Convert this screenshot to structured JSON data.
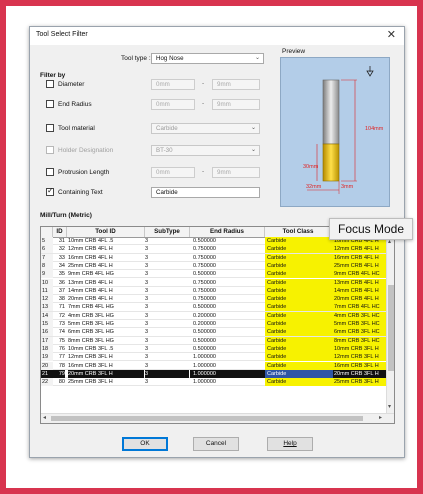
{
  "dialog": {
    "title": "Tool Select Filter",
    "close_glyph": "✕"
  },
  "tool_type": {
    "label": "Tool type :",
    "value": "Hog Nose"
  },
  "preview": {
    "label": "Preview",
    "dim_length": "104mm",
    "dim_flute": "30mm",
    "dim_width": "32mm",
    "dim_radius": "3mm"
  },
  "filter": {
    "heading": "Filter by",
    "diameter": {
      "label": "Diameter",
      "min": "0mm",
      "max": "9mm",
      "checked": false
    },
    "end_radius": {
      "label": "End Radius",
      "min": "0mm",
      "max": "9mm",
      "checked": false
    },
    "tool_material": {
      "label": "Tool material",
      "value": "Carbide",
      "checked": false
    },
    "holder_designation": {
      "label": "Holder Designation",
      "value": "BT-30",
      "checked": false,
      "enabled": false
    },
    "protrusion_length": {
      "label": "Protrusion Length",
      "min": "0mm",
      "max": "9mm",
      "checked": false
    },
    "containing_text": {
      "label": "Containing Text",
      "value": "Carbide",
      "checked": true
    },
    "dash": "-"
  },
  "grid": {
    "heading": "Mill/Turn (Metric)",
    "columns": [
      "",
      "ID",
      "Tool ID",
      "SubType",
      "End Radius",
      "Tool Class",
      ""
    ],
    "rows": [
      [
        "5",
        "31",
        "10mm CRB 4FL .5",
        "3",
        "0.500000",
        "Carbide",
        "10mm CRB 4FL H"
      ],
      [
        "6",
        "32",
        "12mm CRB 4FL H",
        "3",
        "0.750000",
        "Carbide",
        "12mm CRB 4FL H"
      ],
      [
        "7",
        "33",
        "16mm CRB 4FL H",
        "3",
        "0.750000",
        "Carbide",
        "16mm CRB 4FL H"
      ],
      [
        "8",
        "34",
        "25mm CRB 4FL H",
        "3",
        "0.750000",
        "Carbide",
        "25mm CRB 4FL H"
      ],
      [
        "9",
        "35",
        "9mm CRB 4FL HG",
        "3",
        "0.500000",
        "Carbide",
        "9mm CRB 4FL HC"
      ],
      [
        "10",
        "36",
        "13mm CRB 4FL H",
        "3",
        "0.750000",
        "Carbide",
        "13mm CRB 4FL H"
      ],
      [
        "11",
        "37",
        "14mm CRB 4FL H",
        "3",
        "0.750000",
        "Carbide",
        "14mm CRB 4FL H"
      ],
      [
        "12",
        "38",
        "20mm CRB 4FL H",
        "3",
        "0.750000",
        "Carbide",
        "20mm CRB 4FL H"
      ],
      [
        "13",
        "71",
        "7mm CRB 4FL HG",
        "3",
        "0.500000",
        "Carbide",
        "7mm CRB 4FL HC"
      ],
      [
        "14",
        "72",
        "4mm CRB 3FL HG",
        "3",
        "0.200000",
        "Carbide",
        "4mm CRB 3FL HC"
      ],
      [
        "15",
        "73",
        "5mm CRB 3FL HG",
        "3",
        "0.200000",
        "Carbide",
        "5mm CRB 3FL HC"
      ],
      [
        "16",
        "74",
        "6mm CRB 3FL HG",
        "3",
        "0.500000",
        "Carbide",
        "6mm CRB 3FL HC"
      ],
      [
        "17",
        "75",
        "8mm CRB 3FL HG",
        "3",
        "0.500000",
        "Carbide",
        "8mm CRB 3FL HC"
      ],
      [
        "18",
        "76",
        "10mm CRB 3FL .5",
        "3",
        "0.500000",
        "Carbide",
        "10mm CRB 3FL H"
      ],
      [
        "19",
        "77",
        "12mm CRB 3FL H",
        "3",
        "1.000000",
        "Carbide",
        "12mm CRB 3FL H"
      ],
      [
        "20",
        "78",
        "16mm CRB 3FL H",
        "3",
        "1.000000",
        "Carbide",
        "16mm CRB 3FL H"
      ],
      [
        "21",
        "79",
        "20mm CRB 3FL H",
        "3",
        "1.000000",
        "Carbide",
        "20mm CRB 3FL H"
      ],
      [
        "22",
        "80",
        "25mm CRB 3FL H",
        "3",
        "1.000000",
        "Carbide",
        "25mm CRB 3FL H"
      ]
    ],
    "selected_row": 16
  },
  "tooltip": "Focus Mode",
  "buttons": {
    "ok": "OK",
    "cancel": "Cancel",
    "help": "Help"
  },
  "colors": {
    "frame": "#d8344f",
    "tool_class_highlight": "#f7f200",
    "selection": "#111111"
  }
}
